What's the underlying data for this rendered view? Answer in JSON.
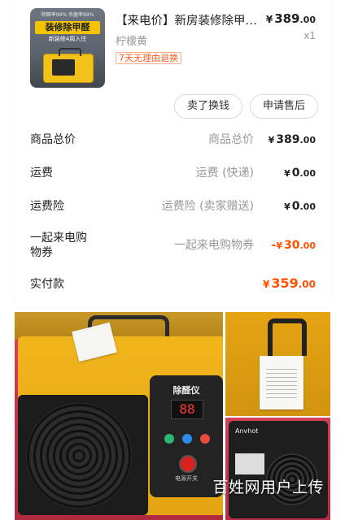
{
  "product": {
    "title": "【来电价】新房装修除甲…",
    "variant": "柠檬黄",
    "tag": "7天无理由退换",
    "price_currency": "¥",
    "price_int": "389",
    "price_dec": ".00",
    "quantity": "x1",
    "thumb_banner": "装修除甲醛",
    "thumb_sub": "新装修4周入住",
    "thumb_top": "除醛率99%  杀菌率99%"
  },
  "actions": {
    "sell_label": "卖了换钱",
    "refund_label": "申请售后"
  },
  "rows": {
    "total": {
      "label": "商品总价",
      "desc": "商品总价",
      "cur": "¥",
      "int": "389",
      "dec": ".00"
    },
    "shipping": {
      "label": "运费",
      "desc": "运费 (快递)",
      "cur": "¥",
      "int": "0",
      "dec": ".00"
    },
    "insurance": {
      "label": "运费险",
      "desc": "运费险 (卖家赠送)",
      "cur": "¥",
      "int": "0",
      "dec": ".00"
    },
    "coupon": {
      "label": "一起来电购物券",
      "desc": "一起来电购物券",
      "sign": "-",
      "cur": "¥",
      "int": "30",
      "dec": ".00"
    },
    "paid": {
      "label": "实付款",
      "cur": "¥",
      "int": "359",
      "dec": ".00"
    }
  },
  "photos": {
    "device_title": "除醛仪",
    "display_value": "88",
    "power_label": "电源开关",
    "brand": "Anvhot",
    "watermark": "百姓网用户上传"
  },
  "colors": {
    "accent": "#ff5000",
    "device_yellow": "#f1b51c"
  }
}
